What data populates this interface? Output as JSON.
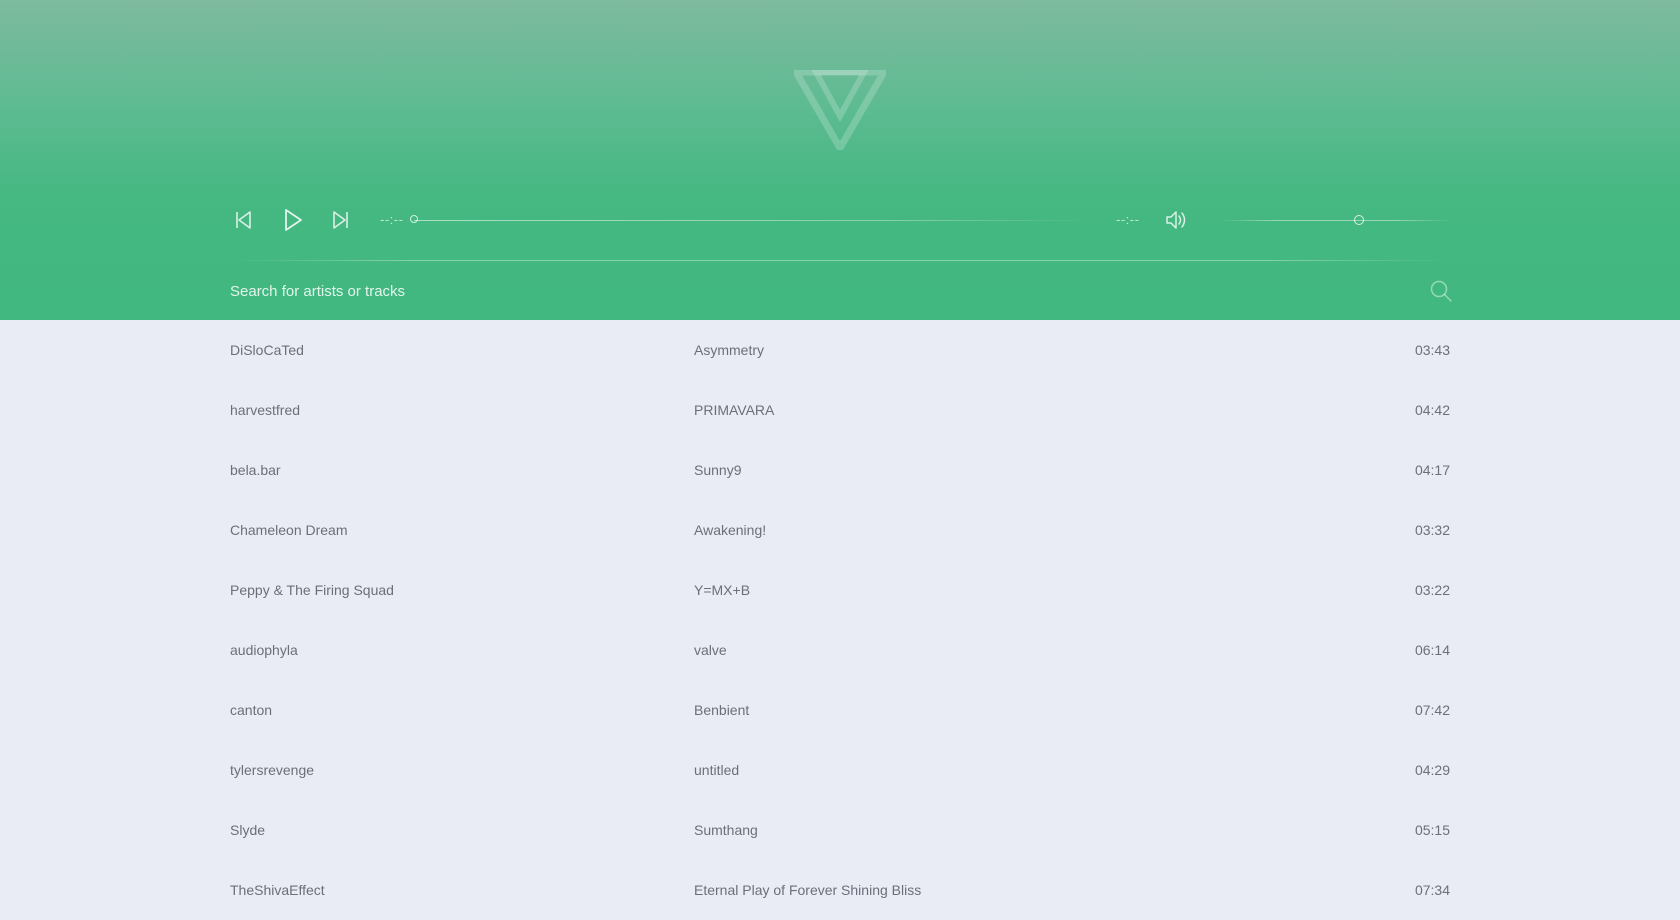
{
  "player": {
    "current_time": "--:--",
    "total_time": "--:--",
    "progress": 0,
    "volume": 0.6,
    "icons": {
      "previous": "skip-previous-icon",
      "play": "play-icon",
      "next": "skip-next-icon",
      "volume": "volume-icon",
      "search": "search-icon",
      "logo": "v-logo-icon"
    }
  },
  "search": {
    "placeholder": "Search for artists or tracks",
    "value": ""
  },
  "colors": {
    "header_top": "#7eba9e",
    "header_bottom": "#40b87f",
    "list_background": "#e9ecf4",
    "text": "#6b6f7a"
  },
  "tracks": [
    {
      "artist": "DiSloCaTed",
      "title": "Asymmetry",
      "duration": "03:43"
    },
    {
      "artist": "harvestfred",
      "title": "PRIMAVARA",
      "duration": "04:42"
    },
    {
      "artist": "bela.bar",
      "title": "Sunny9",
      "duration": "04:17"
    },
    {
      "artist": "Chameleon Dream",
      "title": "Awakening!",
      "duration": "03:32"
    },
    {
      "artist": "Peppy & The Firing Squad",
      "title": "Y=MX+B",
      "duration": "03:22"
    },
    {
      "artist": "audiophyla",
      "title": "valve",
      "duration": "06:14"
    },
    {
      "artist": "canton",
      "title": "Benbient",
      "duration": "07:42"
    },
    {
      "artist": "tylersrevenge",
      "title": "untitled",
      "duration": "04:29"
    },
    {
      "artist": "Slyde",
      "title": "Sumthang",
      "duration": "05:15"
    },
    {
      "artist": "TheShivaEffect",
      "title": "Eternal Play of Forever Shining Bliss",
      "duration": "07:34"
    }
  ]
}
